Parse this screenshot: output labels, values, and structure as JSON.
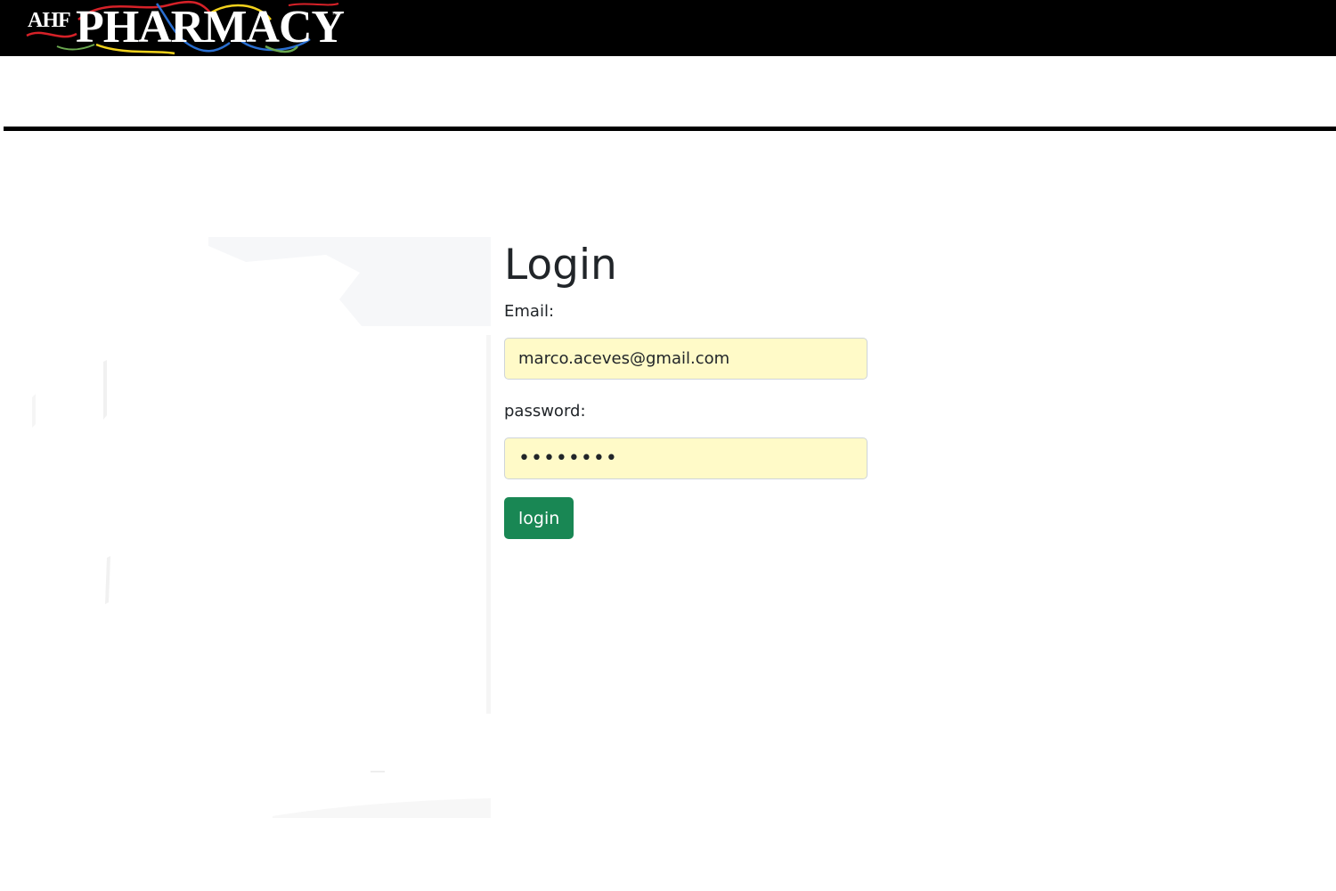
{
  "header": {
    "logo": {
      "prefix": "AHF",
      "name": "PHARMACY",
      "trademark": "™"
    }
  },
  "login": {
    "title": "Login",
    "email_label": "Email:",
    "email_value": "marco.aceves@gmail.com",
    "password_label": "password:",
    "password_value": "********",
    "button_label": "login"
  },
  "colors": {
    "header_bg": "#000000",
    "input_autofill_bg": "#fffac8",
    "button_bg": "#198754",
    "text": "#212529",
    "logo_swirl_red": "#d62128",
    "logo_swirl_yellow": "#f2d21c",
    "logo_swirl_blue": "#2a6fd1",
    "logo_swirl_green": "#6aa84f"
  }
}
